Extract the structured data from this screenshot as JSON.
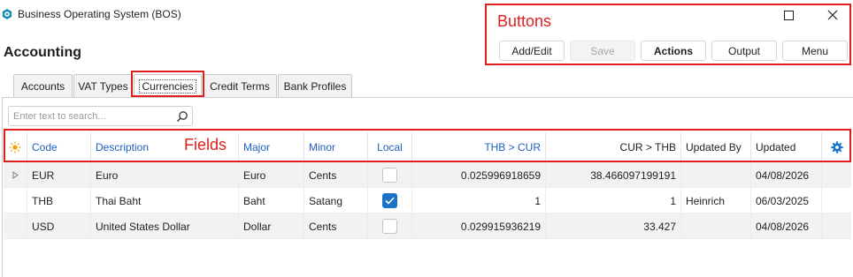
{
  "window": {
    "title": "Business Operating System (BOS)",
    "logo_icon": "bos-hexagon-logo",
    "accent": "#1a73c8"
  },
  "page": {
    "title": "Accounting"
  },
  "annotations": {
    "buttons_label": "Buttons",
    "fields_label": "Fields",
    "color": "#e01e1e"
  },
  "toolbar": {
    "add_edit": "Add/Edit",
    "save": "Save",
    "actions": "Actions",
    "output": "Output",
    "menu": "Menu"
  },
  "tabs": [
    {
      "label": "Accounts"
    },
    {
      "label": "VAT Types"
    },
    {
      "label": "Currencies",
      "active": true
    },
    {
      "label": "Credit Terms"
    },
    {
      "label": "Bank Profiles"
    }
  ],
  "search": {
    "placeholder": "Enter text to search...",
    "value": ""
  },
  "grid": {
    "columns": [
      "Code",
      "Description",
      "Major",
      "Minor",
      "Local",
      "THB > CUR",
      "CUR > THB",
      "Updated By",
      "Updated"
    ],
    "rows": [
      {
        "code": "EUR",
        "description": "Euro",
        "major": "Euro",
        "minor": "Cents",
        "local": false,
        "thb_cur": "0.025996918659",
        "cur_thb": "38.466097199191",
        "updated_by": "",
        "updated": "04/08/2026"
      },
      {
        "code": "THB",
        "description": "Thai Baht",
        "major": "Baht",
        "minor": "Satang",
        "local": true,
        "thb_cur": "1",
        "cur_thb": "1",
        "updated_by": "Heinrich",
        "updated": "06/03/2025"
      },
      {
        "code": "USD",
        "description": "United States Dollar",
        "major": "Dollar",
        "minor": "Cents",
        "local": false,
        "thb_cur": "0.029915936219",
        "cur_thb": "33.427",
        "updated_by": "",
        "updated": "04/08/2026"
      }
    ]
  }
}
